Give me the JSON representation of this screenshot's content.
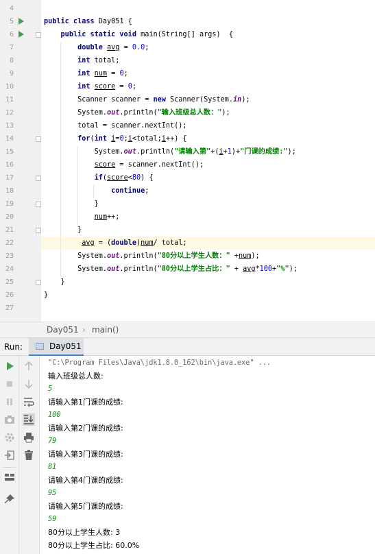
{
  "editor": {
    "line_numbers": [
      "4",
      "5",
      "6",
      "7",
      "8",
      "9",
      "10",
      "11",
      "12",
      "13",
      "14",
      "15",
      "16",
      "17",
      "18",
      "19",
      "20",
      "21",
      "22",
      "23",
      "24",
      "25",
      "26",
      "27"
    ],
    "lines": [
      [],
      [
        {
          "t": "public class ",
          "c": "kw"
        },
        {
          "t": "Day051 {"
        }
      ],
      [
        {
          "t": "    "
        },
        {
          "t": "public static void ",
          "c": "kw"
        },
        {
          "t": "main(String[] args)  {"
        }
      ],
      [
        {
          "t": "        "
        },
        {
          "t": "double ",
          "c": "kw"
        },
        {
          "t": "avg",
          "c": "var"
        },
        {
          "t": " = "
        },
        {
          "t": "0.0",
          "c": "num"
        },
        {
          "t": ";"
        }
      ],
      [
        {
          "t": "        "
        },
        {
          "t": "int ",
          "c": "kw"
        },
        {
          "t": "total;"
        }
      ],
      [
        {
          "t": "        "
        },
        {
          "t": "int ",
          "c": "kw"
        },
        {
          "t": "num",
          "c": "var"
        },
        {
          "t": " = "
        },
        {
          "t": "0",
          "c": "num"
        },
        {
          "t": ";"
        }
      ],
      [
        {
          "t": "        "
        },
        {
          "t": "int ",
          "c": "kw"
        },
        {
          "t": "score",
          "c": "var"
        },
        {
          "t": " = "
        },
        {
          "t": "0",
          "c": "num"
        },
        {
          "t": ";"
        }
      ],
      [
        {
          "t": "        Scanner scanner = "
        },
        {
          "t": "new ",
          "c": "kw"
        },
        {
          "t": "Scanner(System."
        },
        {
          "t": "in",
          "c": "fld"
        },
        {
          "t": ");"
        }
      ],
      [
        {
          "t": "        System."
        },
        {
          "t": "out",
          "c": "fld"
        },
        {
          "t": ".println("
        },
        {
          "t": "\"输入班级总人数：\"",
          "c": "str"
        },
        {
          "t": ");"
        }
      ],
      [
        {
          "t": "        total = scanner.nextInt();"
        }
      ],
      [
        {
          "t": "        "
        },
        {
          "t": "for",
          "c": "kw"
        },
        {
          "t": "("
        },
        {
          "t": "int ",
          "c": "kw"
        },
        {
          "t": "i",
          "c": "var"
        },
        {
          "t": "="
        },
        {
          "t": "0",
          "c": "num"
        },
        {
          "t": ";"
        },
        {
          "t": "i",
          "c": "var"
        },
        {
          "t": "<total;"
        },
        {
          "t": "i",
          "c": "var"
        },
        {
          "t": "++) {"
        }
      ],
      [
        {
          "t": "            System."
        },
        {
          "t": "out",
          "c": "fld"
        },
        {
          "t": ".println("
        },
        {
          "t": "\"请输入第\"",
          "c": "str"
        },
        {
          "t": "+("
        },
        {
          "t": "i",
          "c": "var"
        },
        {
          "t": "+"
        },
        {
          "t": "1",
          "c": "num"
        },
        {
          "t": ")+"
        },
        {
          "t": "\"门课的成绩:\"",
          "c": "str"
        },
        {
          "t": ");"
        }
      ],
      [
        {
          "t": "            "
        },
        {
          "t": "score",
          "c": "var"
        },
        {
          "t": " = scanner.nextInt();"
        }
      ],
      [
        {
          "t": "            "
        },
        {
          "t": "if",
          "c": "kw"
        },
        {
          "t": "("
        },
        {
          "t": "score",
          "c": "var"
        },
        {
          "t": "<"
        },
        {
          "t": "80",
          "c": "num"
        },
        {
          "t": ") {"
        }
      ],
      [
        {
          "t": "                "
        },
        {
          "t": "continue",
          "c": "kw"
        },
        {
          "t": ";"
        }
      ],
      [
        {
          "t": "            }"
        }
      ],
      [
        {
          "t": "            "
        },
        {
          "t": "num",
          "c": "var"
        },
        {
          "t": "++;"
        }
      ],
      [
        {
          "t": "        }"
        }
      ],
      [
        {
          "t": "         "
        },
        {
          "t": "avg",
          "c": "var"
        },
        {
          "t": " = ("
        },
        {
          "t": "double",
          "c": "kw"
        },
        {
          "t": ")"
        },
        {
          "t": "num",
          "c": "var"
        },
        {
          "t": "/ total;"
        }
      ],
      [
        {
          "t": "        System."
        },
        {
          "t": "out",
          "c": "fld"
        },
        {
          "t": ".println("
        },
        {
          "t": "\"80分以上学生人数：\"",
          "c": "str"
        },
        {
          "t": " +"
        },
        {
          "t": "num",
          "c": "var"
        },
        {
          "t": ");"
        }
      ],
      [
        {
          "t": "        System."
        },
        {
          "t": "out",
          "c": "fld"
        },
        {
          "t": ".println("
        },
        {
          "t": "\"80分以上学生占比：\"",
          "c": "str"
        },
        {
          "t": " + "
        },
        {
          "t": "avg",
          "c": "var"
        },
        {
          "t": "*"
        },
        {
          "t": "100",
          "c": "num"
        },
        {
          "t": "+"
        },
        {
          "t": "\"%\"",
          "c": "str"
        },
        {
          "t": ");"
        }
      ],
      [
        {
          "t": "    }"
        }
      ],
      [
        {
          "t": "}"
        }
      ],
      []
    ]
  },
  "breadcrumb": {
    "class_name": "Day051",
    "separator": "›",
    "method": "main()"
  },
  "run_panel": {
    "label": "Run:",
    "tab_label": "Day051",
    "console_lines": [
      {
        "text": "\"C:\\Program Files\\Java\\jdk1.8.0_162\\bin\\java.exe\" ...",
        "kind": "cmd"
      },
      {
        "text": "输入班级总人数:",
        "kind": "out"
      },
      {
        "text": "5",
        "kind": "inp"
      },
      {
        "text": "请输入第1门课的成绩:",
        "kind": "out"
      },
      {
        "text": "100",
        "kind": "inp"
      },
      {
        "text": "请输入第2门课的成绩:",
        "kind": "out"
      },
      {
        "text": "79",
        "kind": "inp"
      },
      {
        "text": "请输入第3门课的成绩:",
        "kind": "out"
      },
      {
        "text": "81",
        "kind": "inp"
      },
      {
        "text": "请输入第4门课的成绩:",
        "kind": "out"
      },
      {
        "text": "95",
        "kind": "inp"
      },
      {
        "text": "请输入第5门课的成绩:",
        "kind": "out"
      },
      {
        "text": "59",
        "kind": "inp"
      },
      {
        "text": "80分以上学生人数: 3",
        "kind": "out"
      },
      {
        "text": "80分以上学生占比: 60.0%",
        "kind": "out"
      }
    ]
  },
  "toolbar": {
    "left_icons": [
      "run-icon",
      "stop-icon",
      "pause-icon",
      "camera-icon",
      "settings-icon",
      "exit-icon",
      "layout-icon",
      "pin-icon"
    ],
    "right_icons": [
      "up-arrow-icon",
      "down-arrow-icon",
      "soft-wrap-icon",
      "scroll-to-end-icon",
      "print-icon",
      "delete-icon"
    ]
  },
  "colors": {
    "keyword": "#000080",
    "string": "#008000",
    "number": "#0000ff",
    "field": "#660e7a",
    "run_green": "#499c54",
    "tab_accent": "#4083c9",
    "current_line": "#fdf9e3"
  }
}
